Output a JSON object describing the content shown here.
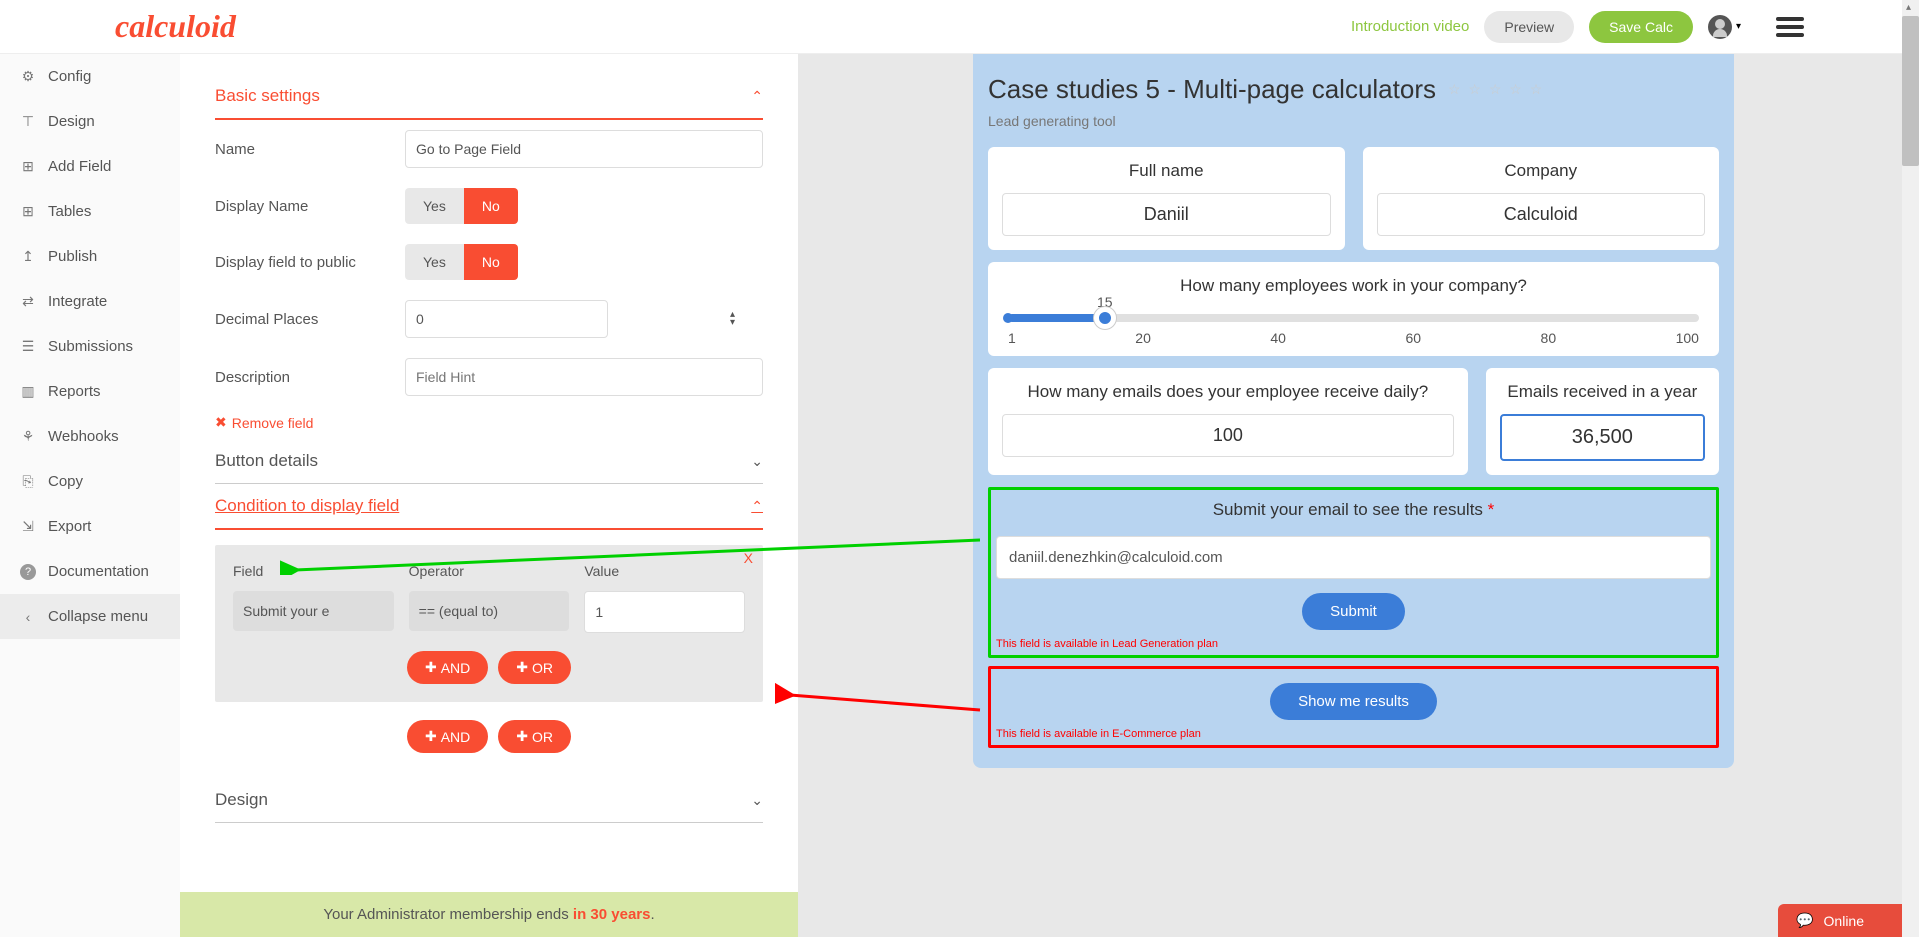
{
  "header": {
    "logo": "calculoid",
    "intro": "Introduction video",
    "preview": "Preview",
    "save": "Save Calc"
  },
  "sidebar": {
    "items": [
      {
        "icon": "⚙",
        "label": "Config"
      },
      {
        "icon": "⊤",
        "label": "Design"
      },
      {
        "icon": "⊞",
        "label": "Add Field"
      },
      {
        "icon": "⊞",
        "label": "Tables"
      },
      {
        "icon": "↥",
        "label": "Publish"
      },
      {
        "icon": "↹",
        "label": "Integrate"
      },
      {
        "icon": "⊟",
        "label": "Submissions"
      },
      {
        "icon": "📊",
        "label": "Reports"
      },
      {
        "icon": "⚗",
        "label": "Webhooks"
      },
      {
        "icon": "⎘",
        "label": "Copy"
      },
      {
        "icon": "⇲",
        "label": "Export"
      },
      {
        "icon": "?",
        "label": "Documentation"
      },
      {
        "icon": "‹",
        "label": "Collapse menu"
      }
    ]
  },
  "settings": {
    "basic_title": "Basic settings",
    "name_label": "Name",
    "name_value": "Go to Page Field",
    "display_name_label": "Display Name",
    "display_public_label": "Display field to public",
    "yes": "Yes",
    "no": "No",
    "decimal_label": "Decimal Places",
    "decimal_value": "0",
    "description_label": "Description",
    "description_placeholder": "Field Hint",
    "remove": "Remove field",
    "button_details": "Button details",
    "condition_title": "Condition to display field",
    "field_label": "Field",
    "operator_label": "Operator",
    "value_label": "Value",
    "field_value": "Submit your e",
    "operator_value": "== (equal to)",
    "value_value": "1",
    "and": "AND",
    "or": "OR",
    "close_x": "X",
    "design": "Design"
  },
  "calc": {
    "title": "Case studies 5 - Multi-page calculators",
    "subtitle": "Lead generating tool",
    "fullname_label": "Full name",
    "fullname_value": "Daniil",
    "company_label": "Company",
    "company_value": "Calculoid",
    "employees_label": "How many employees work in your company?",
    "slider_value": "15",
    "slider_ticks": [
      "1",
      "20",
      "40",
      "60",
      "80",
      "100"
    ],
    "emails_label": "How many emails does your employee receive daily?",
    "emails_value": "100",
    "year_label": "Emails received in a year",
    "year_value": "36,500",
    "submit_label": "Submit your email to see the results",
    "email_value": "daniil.denezhkin@calculoid.com",
    "submit_btn": "Submit",
    "leadgen_note": "This field is available in Lead Generation plan",
    "results_btn": "Show me results",
    "ecommerce_note": "This field is available in E-Commerce plan"
  },
  "footer": {
    "text_before": "Your Administrator membership ends ",
    "highlight": "in 30 years",
    "text_after": "."
  },
  "chat": {
    "label": "Online"
  }
}
